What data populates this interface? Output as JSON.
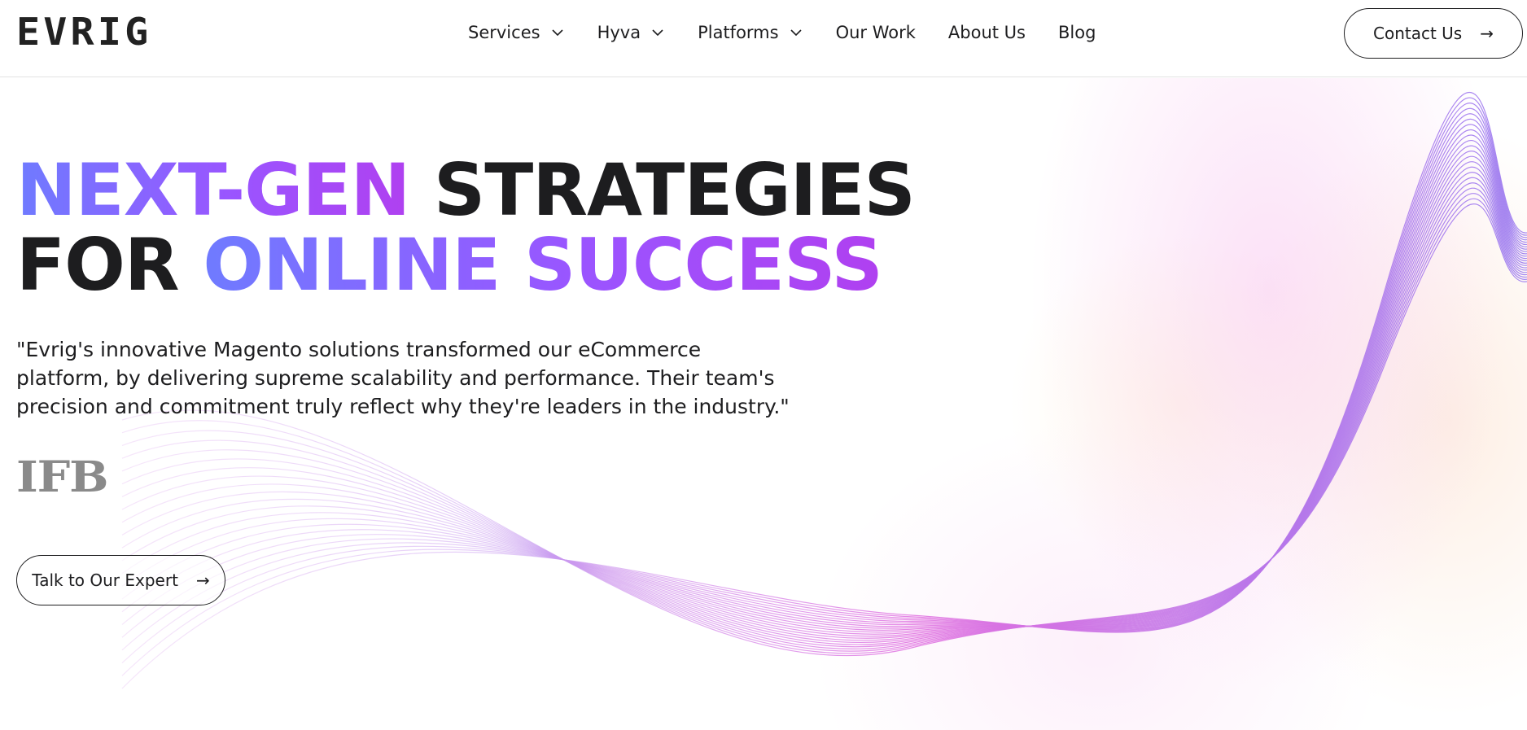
{
  "header": {
    "logo_text": "EVRIG",
    "nav": [
      {
        "label": "Services",
        "has_dropdown": true
      },
      {
        "label": "Hyva",
        "has_dropdown": true
      },
      {
        "label": "Platforms",
        "has_dropdown": true
      },
      {
        "label": "Our Work",
        "has_dropdown": false
      },
      {
        "label": "About Us",
        "has_dropdown": false
      },
      {
        "label": "Blog",
        "has_dropdown": false
      }
    ],
    "contact_label": "Contact Us",
    "contact_icon": "arrow-right-icon"
  },
  "hero": {
    "headline": {
      "line1_gradient": "NEXT-GEN",
      "line1_dark": "STRATEGIES",
      "line2_dark": "FOR",
      "line2_gradient": "ONLINE SUCCESS"
    },
    "quote": "\"Evrig's innovative Magento solutions transformed our eCommerce platform, by delivering supreme scalability and performance. Their team's precision and commitment truly reflect why they're leaders in the industry.\"",
    "client_logo_text": "IFB",
    "cta_label": "Talk to Our Expert",
    "cta_icon": "arrow-right-icon"
  },
  "colors": {
    "gradient_start": "#6f7bff",
    "gradient_mid": "#9a55ff",
    "gradient_end": "#b040f0",
    "wave_purple": "#9b7bf0",
    "wave_pink": "#e070e0",
    "text_dark": "#1d1d1f",
    "logo_gray": "#8a8a8a"
  }
}
